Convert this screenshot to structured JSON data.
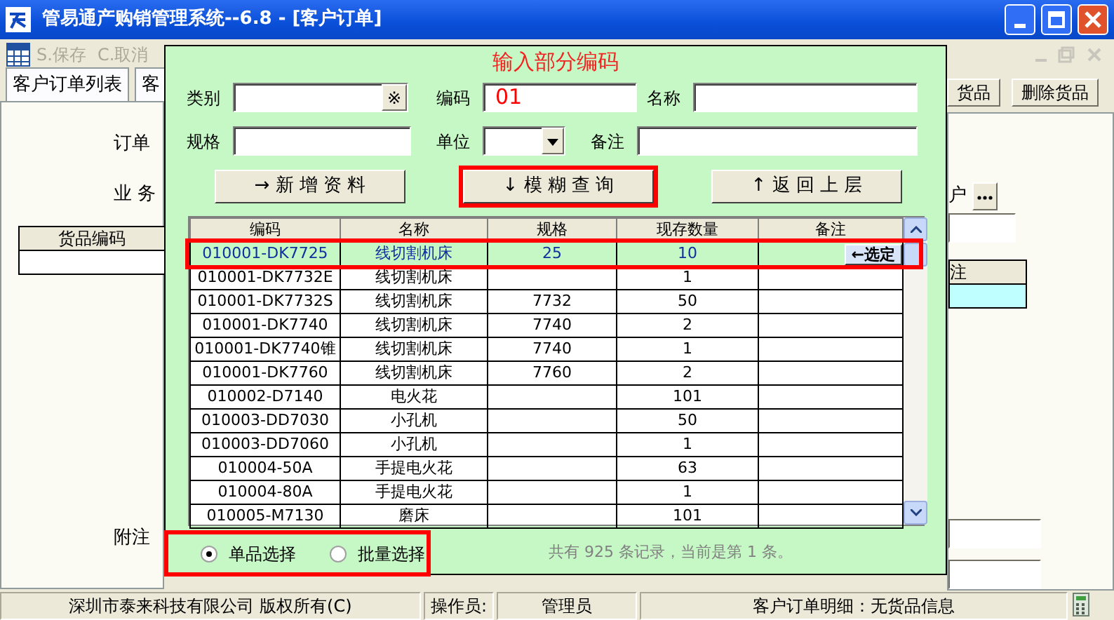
{
  "window": {
    "title": "管易通产购销管理系统--6.8 - [客户订单]"
  },
  "toolbar": [
    {
      "label": "S.保存",
      "disabled": true
    },
    {
      "label": "C.取消",
      "disabled": true
    }
  ],
  "background": {
    "tabs": [
      "客户订单列表",
      "客"
    ],
    "labels": [
      "订单",
      "业 务"
    ],
    "note_label": "附注",
    "table_column": "货品编码",
    "buttons": [
      "货品",
      "删除货品"
    ],
    "right_label": "户",
    "right_column": "注"
  },
  "dialog": {
    "title": "输入部分编码",
    "fields": [
      {
        "label": "类别",
        "kind": "picker",
        "button": "※"
      },
      {
        "label": "编码",
        "kind": "text",
        "value": "01"
      },
      {
        "label": "名称",
        "kind": "text"
      },
      {
        "label": "规格",
        "kind": "text"
      },
      {
        "label": "单位",
        "kind": "select"
      },
      {
        "label": "备注",
        "kind": "text"
      }
    ],
    "buttons": [
      {
        "label": "→ 新 增 资 料",
        "highlighted": false
      },
      {
        "label": "↓ 模 糊 查 询",
        "highlighted": true
      },
      {
        "label": "↑ 返 回 上 层",
        "highlighted": false
      }
    ],
    "grid": {
      "columns": [
        "编码",
        "名称",
        "规格",
        "现存数量",
        "备注"
      ],
      "select_button": "←选定",
      "rows": [
        {
          "code": "010001-DK7725",
          "name": "线切割机床",
          "spec": "25",
          "qty": "10",
          "selected": true
        },
        {
          "code": "010001-DK7732E",
          "name": "线切割机床",
          "qty": "1",
          "selected": false
        },
        {
          "code": "010001-DK7732S",
          "name": "线切割机床",
          "spec": "7732",
          "qty": "50",
          "selected": false
        },
        {
          "code": "010001-DK7740",
          "name": "线切割机床",
          "spec": "7740",
          "qty": "2",
          "selected": false
        },
        {
          "code": "010001-DK7740锥",
          "name": "线切割机床",
          "spec": "7740",
          "qty": "1",
          "selected": false
        },
        {
          "code": "010001-DK7760",
          "name": "线切割机床",
          "spec": "7760",
          "qty": "2",
          "selected": false
        },
        {
          "code": "010002-D7140",
          "name": "电火花",
          "qty": "101",
          "selected": false
        },
        {
          "code": "010003-DD7030",
          "name": "小孔机",
          "qty": "50",
          "selected": false
        },
        {
          "code": "010003-DD7060",
          "name": "小孔机",
          "qty": "1",
          "selected": false
        },
        {
          "code": "010004-50A",
          "name": "手提电火花",
          "qty": "63",
          "selected": false
        },
        {
          "code": "010004-80A",
          "name": "手提电火花",
          "qty": "1",
          "selected": false
        },
        {
          "code": "010005-M7130",
          "name": "磨床",
          "qty": "101",
          "selected": false
        }
      ]
    },
    "mode": {
      "highlighted": true,
      "options": [
        {
          "label": "单品选择",
          "selected": true
        },
        {
          "label": "批量选择",
          "selected": false
        }
      ]
    },
    "record_info": "共有 925 条记录，当前是第 1 条。"
  },
  "status_bar": [
    "深圳市泰来科技有限公司 版权所有(C)",
    "操作员:",
    "管理员",
    "客户订单明细：无货品信息"
  ]
}
